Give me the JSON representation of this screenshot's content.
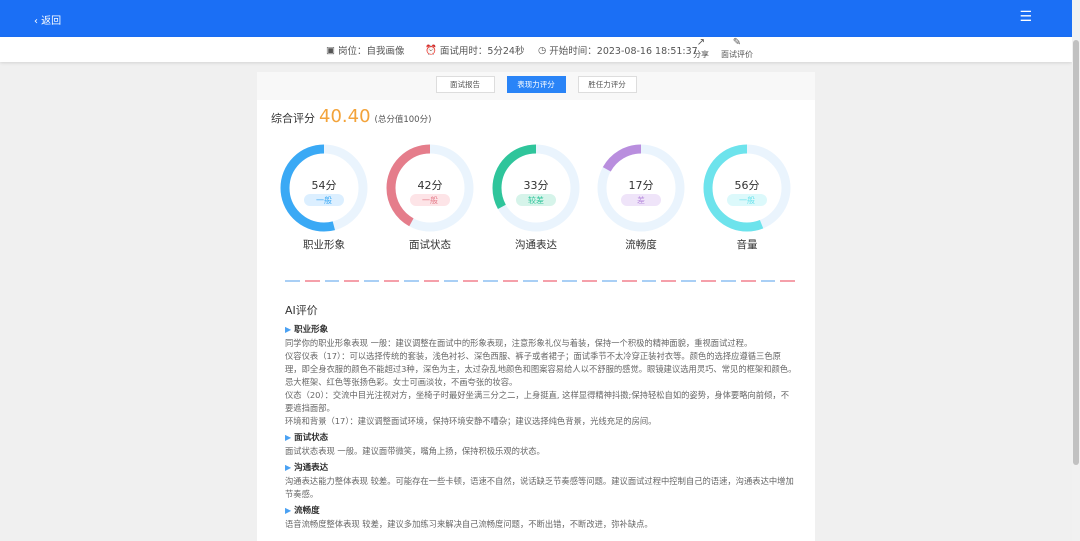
{
  "header": {
    "back_label": "‹ 返回",
    "menu_icon": "☰"
  },
  "info": {
    "position": "岗位：自我画像",
    "duration": "面试用时：5分24秒",
    "start_time": "开始时间：2023-08-16 18:51:37",
    "share": "分享",
    "review": "面试评价"
  },
  "tabs": [
    {
      "label": "面试报告"
    },
    {
      "label": "表现力评分"
    },
    {
      "label": "胜任力评分"
    }
  ],
  "total": {
    "label": "综合评分",
    "score": "40.40",
    "max": "(总分值100分)"
  },
  "gauges": [
    {
      "name": "职业形象",
      "value": 54,
      "value_text": "54分",
      "level": "一般",
      "color": "#3aa9f5",
      "badge_bg": "#dcefff"
    },
    {
      "name": "面试状态",
      "value": 42,
      "value_text": "42分",
      "level": "一般",
      "color": "#e57d8b",
      "badge_bg": "#fde4e7"
    },
    {
      "name": "沟通表达",
      "value": 33,
      "value_text": "33分",
      "level": "较差",
      "color": "#2fc59b",
      "badge_bg": "#d6f4ea"
    },
    {
      "name": "流畅度",
      "value": 17,
      "value_text": "17分",
      "level": "差",
      "color": "#b98ede",
      "badge_bg": "#efe4f9"
    },
    {
      "name": "音量",
      "value": 56,
      "value_text": "56分",
      "level": "一般",
      "color": "#6de3ec",
      "badge_bg": "#dcf9fb"
    }
  ],
  "ai": {
    "title": "AI评价",
    "sections": [
      {
        "heading": "职业形象",
        "lines": [
          "同学你的职业形象表现 一般：建议调整在面试中的形象表现，注意形象礼仪与着装，保持一个积极的精神面貌，重视面试过程。",
          "仪容仪表（17）：可以选择传统的套装，浅色衬衫、深色西服、裤子或者裙子；面试季节不太冷穿正装衬衣等。颜色的选择应遵循三色原理，即全身衣服的颜色不能超过3种，深色为主，太过杂乱地颜色和图案容易给人以不舒服的感觉。眼镜建议选用灵巧、常见的框架和颜色。忌大框架、红色等张扬色彩。女士可画淡妆，不画夸张的妆容。",
          "仪态（20）：交流中目光注视对方，坐椅子时最好坐满三分之二，上身挺直, 这样显得精神抖擞;保持轻松自如的姿势，身体要略向前倾，不要遮挡面部。",
          "环境和背景（17）：建议调整面试环境，保持环境安静不嘈杂；建议选择纯色背景，光线充足的房间。"
        ]
      },
      {
        "heading": "面试状态",
        "lines": [
          "面试状态表现 一般。建议面带微笑，嘴角上扬，保持积极乐观的状态。"
        ]
      },
      {
        "heading": "沟通表达",
        "lines": [
          "沟通表达能力整体表现 较差。可能存在一些卡顿，语速不自然，说话缺乏节奏感等问题。建议面试过程中控制自己的语速，沟通表达中增加节奏感。"
        ]
      },
      {
        "heading": "流畅度",
        "lines": [
          "语音流畅度整体表现 较差，建议多加练习来解决自己流畅度问题，不断出错，不断改进，弥补缺点。"
        ]
      }
    ]
  }
}
